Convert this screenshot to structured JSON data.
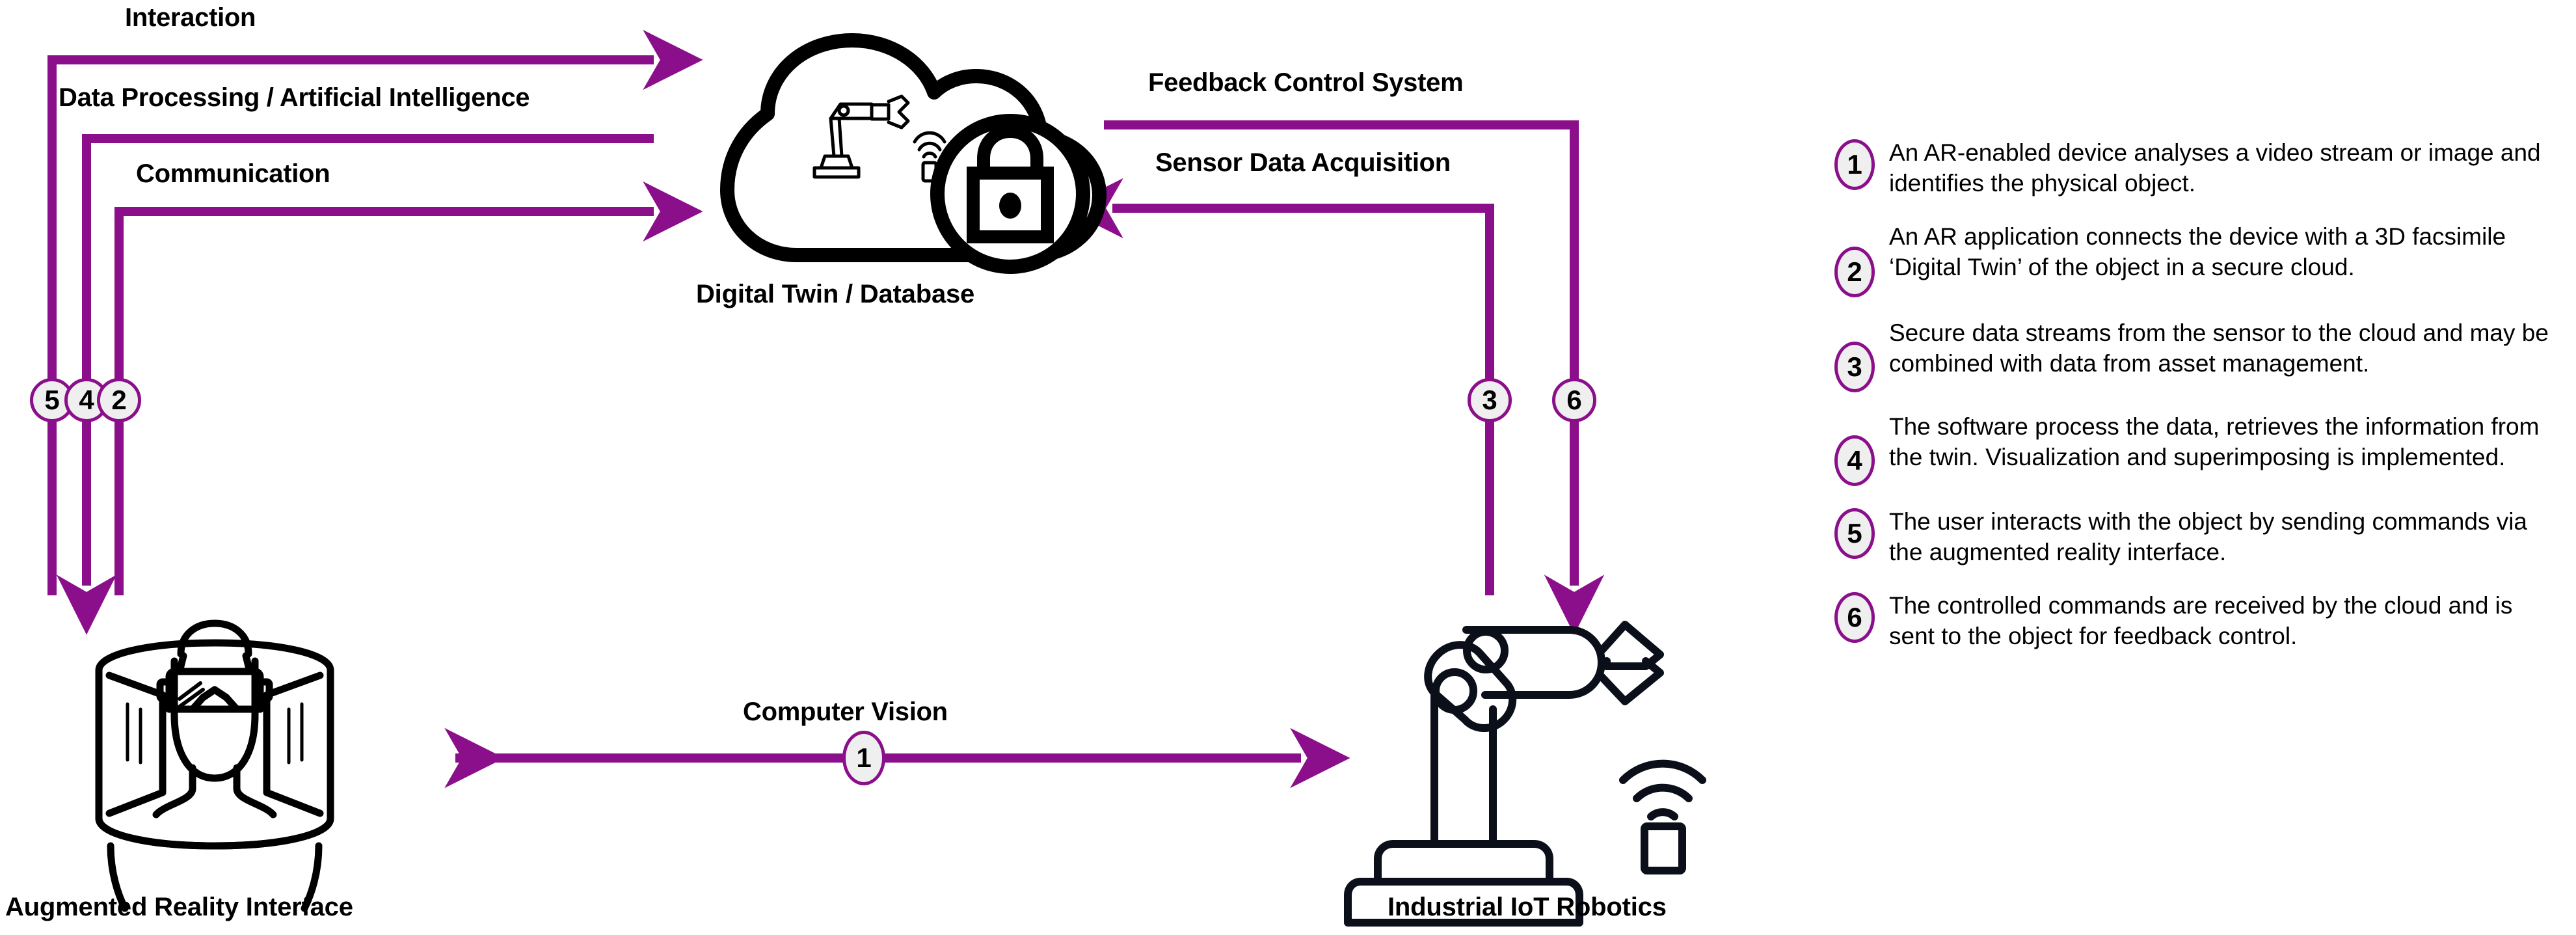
{
  "colors": {
    "accent": "#8b0f8b",
    "badge_fill": "#efefef",
    "ink": "#000000",
    "background": "#ffffff"
  },
  "nodes": [
    {
      "id": "ar",
      "caption": "Augmented Reality Interface",
      "icon": "ar-headset-person-icon"
    },
    {
      "id": "cloud",
      "caption": "Digital Twin / Database",
      "icon": "secure-cloud-robot-icon"
    },
    {
      "id": "robot",
      "caption": "Industrial IoT Robotics",
      "icon": "industrial-robot-arm-icon"
    }
  ],
  "flows": [
    {
      "id": "interaction",
      "label": "Interaction",
      "step": "5",
      "direction": "ar-to-cloud"
    },
    {
      "id": "data-processing",
      "label": "Data Processing / Artificial Intelligence",
      "step": "4",
      "direction": "cloud-to-ar"
    },
    {
      "id": "communication",
      "label": "Communication",
      "step": "2",
      "direction": "ar-to-cloud"
    },
    {
      "id": "feedback-control",
      "label": "Feedback Control System",
      "step": "6",
      "direction": "cloud-to-robot"
    },
    {
      "id": "sensor-data",
      "label": "Sensor Data Acquisition",
      "step": "3",
      "direction": "robot-to-cloud"
    },
    {
      "id": "computer-vision",
      "label": "Computer Vision",
      "step": "1",
      "direction": "bidirectional"
    }
  ],
  "legend": {
    "items": [
      {
        "number": "1",
        "text": "An AR-enabled device analyses a  video stream or image and identifies the physical object."
      },
      {
        "number": "2",
        "text": "An AR application connects the device with a 3D facsimile ‘Digital Twin’ of the object in a secure cloud."
      },
      {
        "number": "3",
        "text": "Secure data streams from the sensor  to the cloud and may be combined with  data from asset management."
      },
      {
        "number": "4",
        "text": "The software process the data, retrieves the information from the twin. Visualization and superimposing is implemented."
      },
      {
        "number": "5",
        "text": "The user interacts with the object by sending commands via the augmented reality interface."
      },
      {
        "number": "6",
        "text": "The controlled commands are received by the cloud and is sent to the object for feedback control."
      }
    ]
  }
}
